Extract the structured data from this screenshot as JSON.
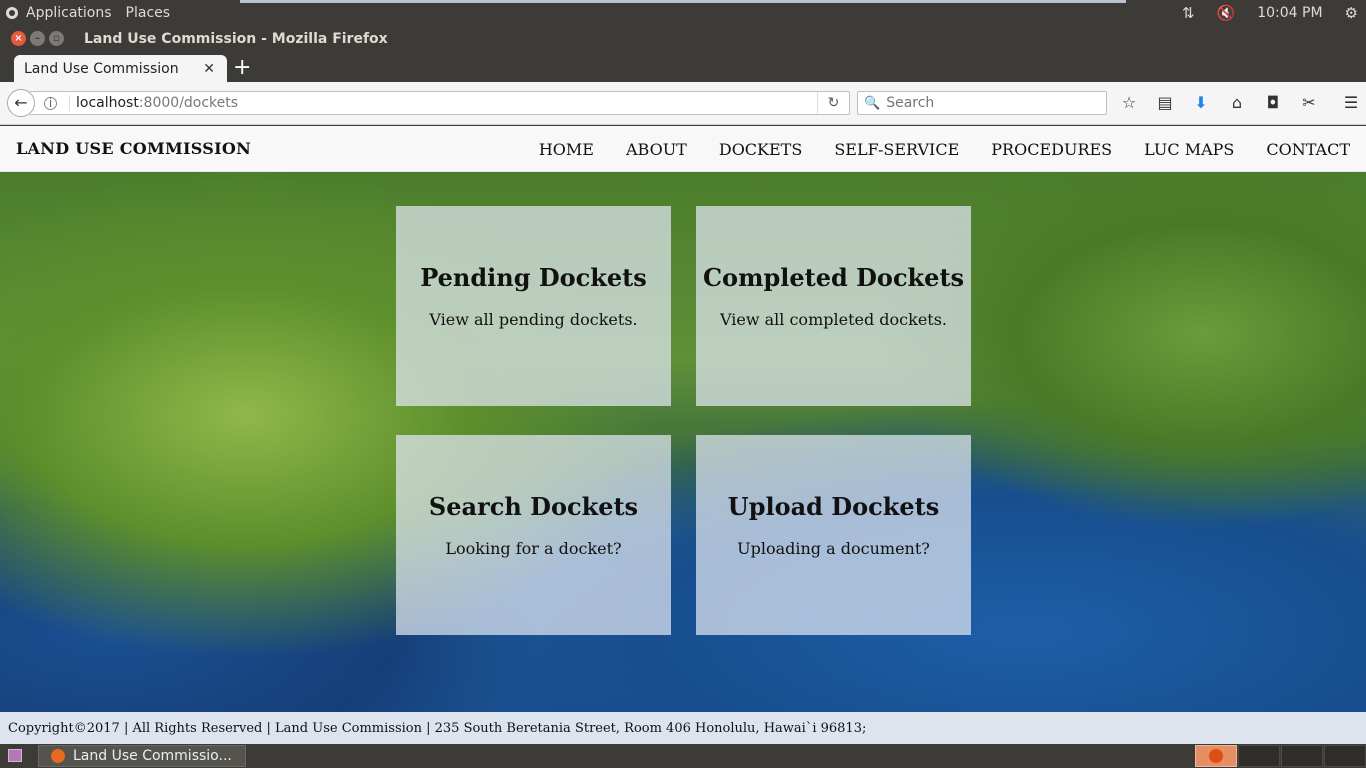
{
  "os_panel": {
    "applications": "Applications",
    "places": "Places",
    "clock": "10:04 PM"
  },
  "window": {
    "title": "Land Use Commission - Mozilla Firefox"
  },
  "tabs": [
    {
      "label": "Land Use Commission"
    }
  ],
  "browser": {
    "url_host": "localhost",
    "url_rest": ":8000/dockets",
    "search_placeholder": "Search"
  },
  "site": {
    "brand": "LAND USE COMMISSION",
    "nav": [
      "HOME",
      "ABOUT",
      "DOCKETS",
      "SELF-SERVICE",
      "PROCEDURES",
      "LUC MAPS",
      "CONTACT"
    ],
    "cards": [
      {
        "title": "Pending Dockets",
        "desc": "View all pending dockets."
      },
      {
        "title": "Completed Dockets",
        "desc": "View all completed dockets."
      },
      {
        "title": "Search Dockets",
        "desc": "Looking for a docket?"
      },
      {
        "title": "Upload Dockets",
        "desc": "Uploading a document?"
      }
    ],
    "footer": "Copyright©2017 | All Rights Reserved | Land Use Commission | 235 South Beretania Street, Room 406 Honolulu, Hawai`i 96813;"
  },
  "taskbar": {
    "task_label": "Land Use Commissio..."
  },
  "colors": {
    "panel": "#3c3b37",
    "card_bg": "#e1e8f2",
    "footer_bg": "#dde4ee",
    "close_button": "#e8583b"
  }
}
